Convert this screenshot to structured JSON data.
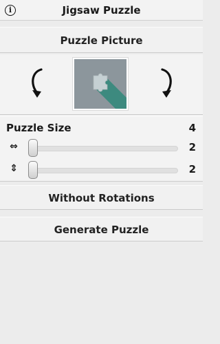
{
  "header": {
    "title": "Jigsaw Puzzle",
    "info_icon": "info-icon"
  },
  "picture": {
    "button_label": "Puzzle Picture",
    "rotate_left_icon": "rotate-left-icon",
    "rotate_right_icon": "rotate-right-icon",
    "thumbnail_icon": "puzzle-piece-thumbnail"
  },
  "size": {
    "label": "Puzzle Size",
    "total": "4",
    "width": {
      "icon": "horizontal-arrows-icon",
      "glyph": "⇔",
      "value": "2",
      "fraction": 0
    },
    "height": {
      "icon": "vertical-arrows-icon",
      "glyph": "⇕",
      "value": "2",
      "fraction": 0
    }
  },
  "buttons": {
    "rotations_label": "Without Rotations",
    "generate_label": "Generate Puzzle"
  },
  "colors": {
    "thumbnail_bg": "#8c969c",
    "thumbnail_shadow": "#3d8a7f",
    "piece": "#c5d0d3"
  }
}
